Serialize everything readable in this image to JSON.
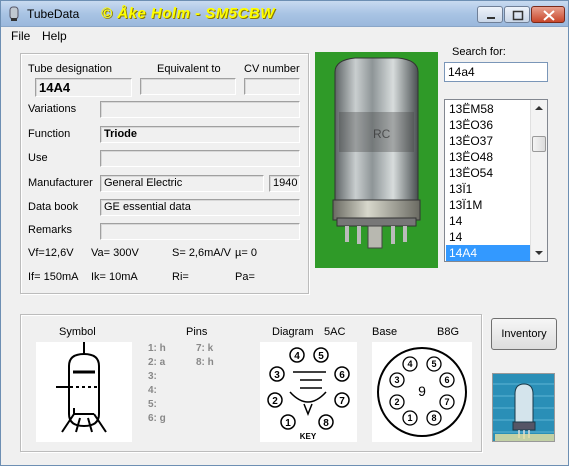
{
  "window": {
    "title": "TubeData",
    "copyright": "© Åke Holm - SM5CBW"
  },
  "menu": {
    "file": "File",
    "help": "Help"
  },
  "labels": {
    "tube_designation": "Tube designation",
    "equivalent_to": "Equivalent to",
    "cv_number": "CV number",
    "variations": "Variations",
    "function": "Function",
    "use": "Use",
    "manufacturer": "Manufacturer",
    "data_book": "Data book",
    "remarks": "Remarks"
  },
  "values": {
    "tube_designation": "14A4",
    "equivalent_to": "",
    "cv_number": "",
    "variations": "",
    "function": "Triode",
    "use": "",
    "manufacturer": "General Electric",
    "year": "1940",
    "data_book": "GE essential data",
    "remarks": ""
  },
  "params": {
    "vf": "Vf=12,6V",
    "va": "Va=  300V",
    "s": "S= 2,6mA/V",
    "mu": "µ=    0",
    "if": "If= 150mA",
    "ik": "Ik=  10mA",
    "ri": "Ri=",
    "pa": "Pa="
  },
  "search": {
    "label": "Search for:",
    "value": "14a4"
  },
  "list": {
    "items": [
      "13ËM58",
      "13ËO36",
      "13ËO37",
      "13ËO48",
      "13ËO54",
      "13Ï1",
      "13Ï1M",
      "14",
      "14",
      "14A4"
    ],
    "selected_index": 9
  },
  "bottom": {
    "symbol_label": "Symbol",
    "pins_label": "Pins",
    "diagram_label": "Diagram",
    "diagram_code": "5AC",
    "base_label": "Base",
    "base_code": "B8G",
    "pins_left": [
      "1: h",
      "2: a",
      "3:",
      "4:",
      "5:",
      "6: g"
    ],
    "pins_right": [
      "7: k",
      "8: h"
    ],
    "diagram_pin_numbers": [
      "4",
      "5",
      "3",
      "6",
      "2",
      "7",
      "1",
      "8"
    ],
    "key_label": "KEY",
    "base_pin_numbers": [
      "4",
      "5",
      "3",
      "6",
      "2",
      "7",
      "1",
      "8",
      "9"
    ]
  },
  "buttons": {
    "inventory": "Inventory"
  },
  "colors": {
    "title_accent": "#ffff00",
    "selection": "#3399ff",
    "photo_bg": "#2f9a28"
  }
}
